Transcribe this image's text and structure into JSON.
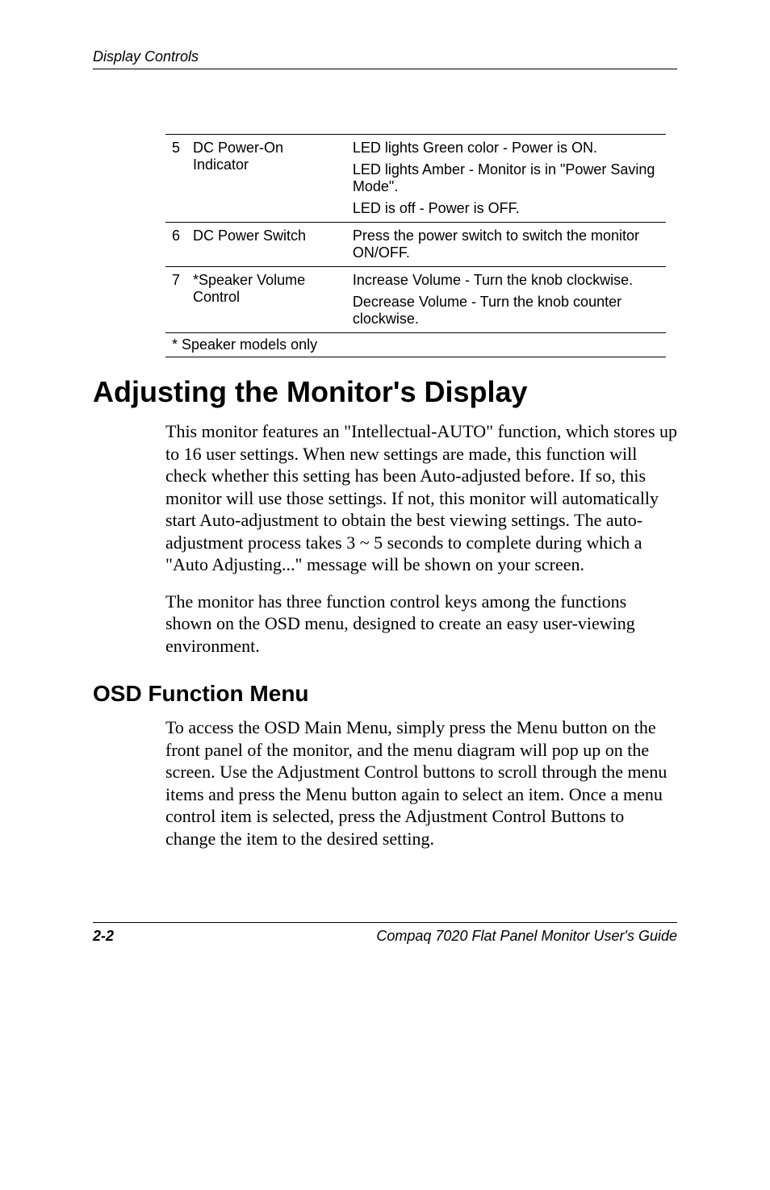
{
  "running_head": "Display Controls",
  "table": {
    "rows": [
      {
        "num": "5",
        "name": "DC Power-On Indicator",
        "desc": [
          "LED lights Green color - Power is ON.",
          "LED lights Amber - Monitor is in \"Power Saving Mode\".",
          "LED is off - Power is OFF."
        ]
      },
      {
        "num": "6",
        "name": "DC Power Switch",
        "desc": [
          "Press the power switch to switch the monitor ON/OFF."
        ]
      },
      {
        "num": "7",
        "name": "*Speaker Volume Control",
        "desc": [
          "Increase Volume - Turn the knob clockwise.",
          "Decrease Volume - Turn the knob counter clockwise."
        ]
      }
    ],
    "footnote": "* Speaker models only"
  },
  "h1": "Adjusting the Monitor's Display",
  "para1": "This monitor features an \"Intellectual-AUTO\" function, which stores up to 16 user settings. When new settings are made, this function will check whether this setting has been Auto-adjusted before. If so, this monitor will use those settings. If not, this monitor will automatically start Auto-adjustment to obtain the best viewing settings. The auto-adjustment process takes 3 ~ 5 seconds to complete during which a \"Auto Adjusting...\" message will be shown on your screen.",
  "para2": "The monitor has three function control keys among the functions shown on the OSD menu, designed to create an easy user-viewing environment.",
  "h2": "OSD Function Menu",
  "para3": "To access the OSD Main Menu, simply press the Menu button on the front panel of the monitor, and the menu diagram will pop up on the screen. Use the Adjustment Control buttons to scroll through the menu items and press the Menu button again to select an item. Once a menu control item is selected, press the Adjustment Control Buttons to change the item to the desired setting.",
  "footer": {
    "page": "2-2",
    "title": "Compaq 7020 Flat Panel Monitor User's Guide"
  }
}
